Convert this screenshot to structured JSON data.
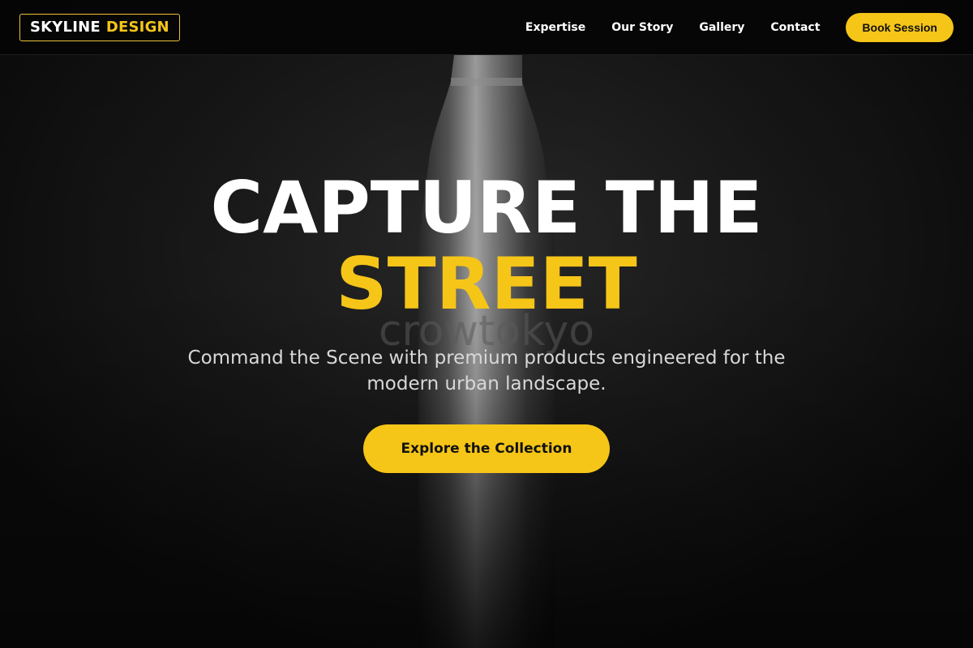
{
  "brand": {
    "name_primary": "SKYLINE",
    "name_accent": "DESIGN"
  },
  "nav": {
    "links": [
      "Expertise",
      "Our Story",
      "Gallery",
      "Contact"
    ],
    "cta_label": "Book Session"
  },
  "hero": {
    "headline_line1": "CAPTURE THE",
    "headline_line2": "STREET",
    "subtitle": "Command the Scene with premium products engineered for the modern urban landscape.",
    "cta_label": "Explore the Collection",
    "background_text": "crowtokyo"
  },
  "colors": {
    "accent": "#f5c518",
    "background": "#0c0c0c",
    "text_primary": "#ffffff",
    "text_secondary": "#d8d8d8"
  }
}
